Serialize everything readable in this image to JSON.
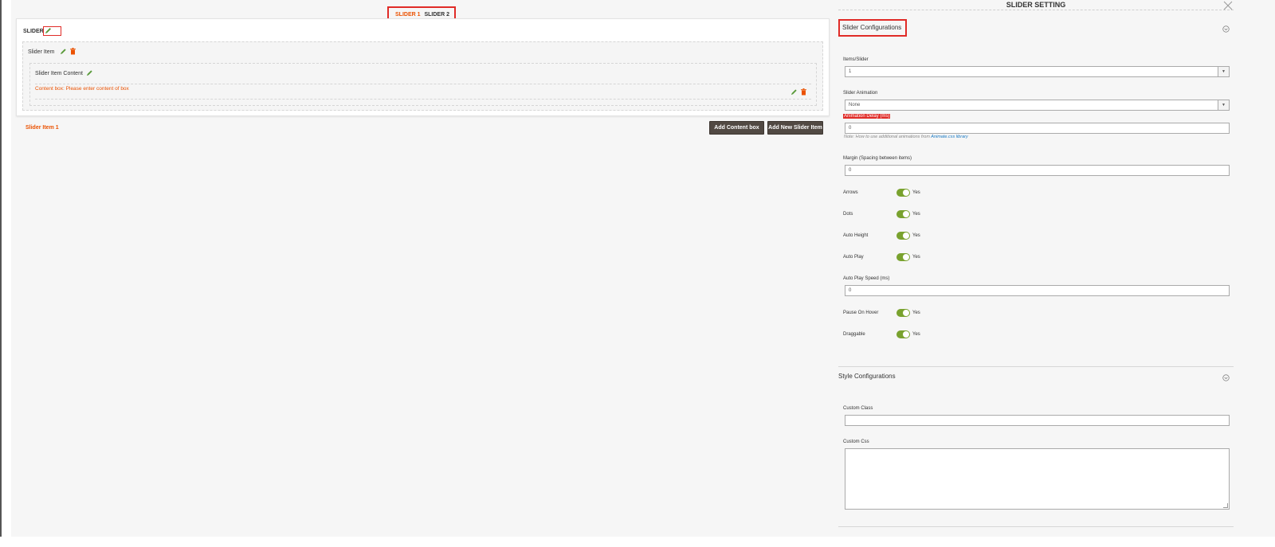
{
  "builder": {
    "tabs": [
      {
        "label": "SLIDER 1",
        "active": true
      },
      {
        "label": "SLIDER 2",
        "active": false
      }
    ],
    "slider_title": "SLIDER",
    "slider_item_title": "Slider Item",
    "slider_item_content_title": "Slider Item Content",
    "content_placeholder": "Content box: Please enter content of box",
    "slider_item_label": "Slider Item 1",
    "add_content_button": "Add Content box",
    "add_slider_button": "Add New Slider Item",
    "icons": {
      "edit": "pencil-icon",
      "delete": "trash-icon"
    }
  },
  "panel": {
    "title": "SLIDER SETTING",
    "slider_config": {
      "heading": "Slider Configurations",
      "items_slider_label": "Items/Slider",
      "items_slider_value": "1",
      "animation_label": "Slider Animation",
      "animation_value": "None",
      "delay_label": "Animation Delay (ms)",
      "delay_value": "0",
      "note_text": "Note: How to use additional animations from",
      "note_link": "Animate.css library",
      "margin_label": "Margin (Spacing between items)",
      "margin_value": "0",
      "arrows_label": "Arrows",
      "arrows_value": "Yes",
      "dots_label": "Dots",
      "dots_value": "Yes",
      "auto_height_label": "Auto Height",
      "auto_height_value": "Yes",
      "auto_play_label": "Auto Play",
      "auto_play_value": "Yes",
      "auto_play_speed_label": "Auto Play Speed (ms)",
      "auto_play_speed_value": "0",
      "pause_label": "Pause On Hover",
      "pause_value": "Yes",
      "draggable_label": "Draggable",
      "draggable_value": "Yes"
    },
    "style_config": {
      "heading": "Style Configurations",
      "custom_class_label": "Custom Class",
      "custom_class_value": "",
      "custom_css_label": "Custom Css",
      "custom_css_value": ""
    }
  },
  "colors": {
    "accent_orange": "#eb5202",
    "highlight_red": "#e02b27",
    "button_dark": "#514943",
    "toggle_green": "#79a22e",
    "link_blue": "#1979c3"
  }
}
